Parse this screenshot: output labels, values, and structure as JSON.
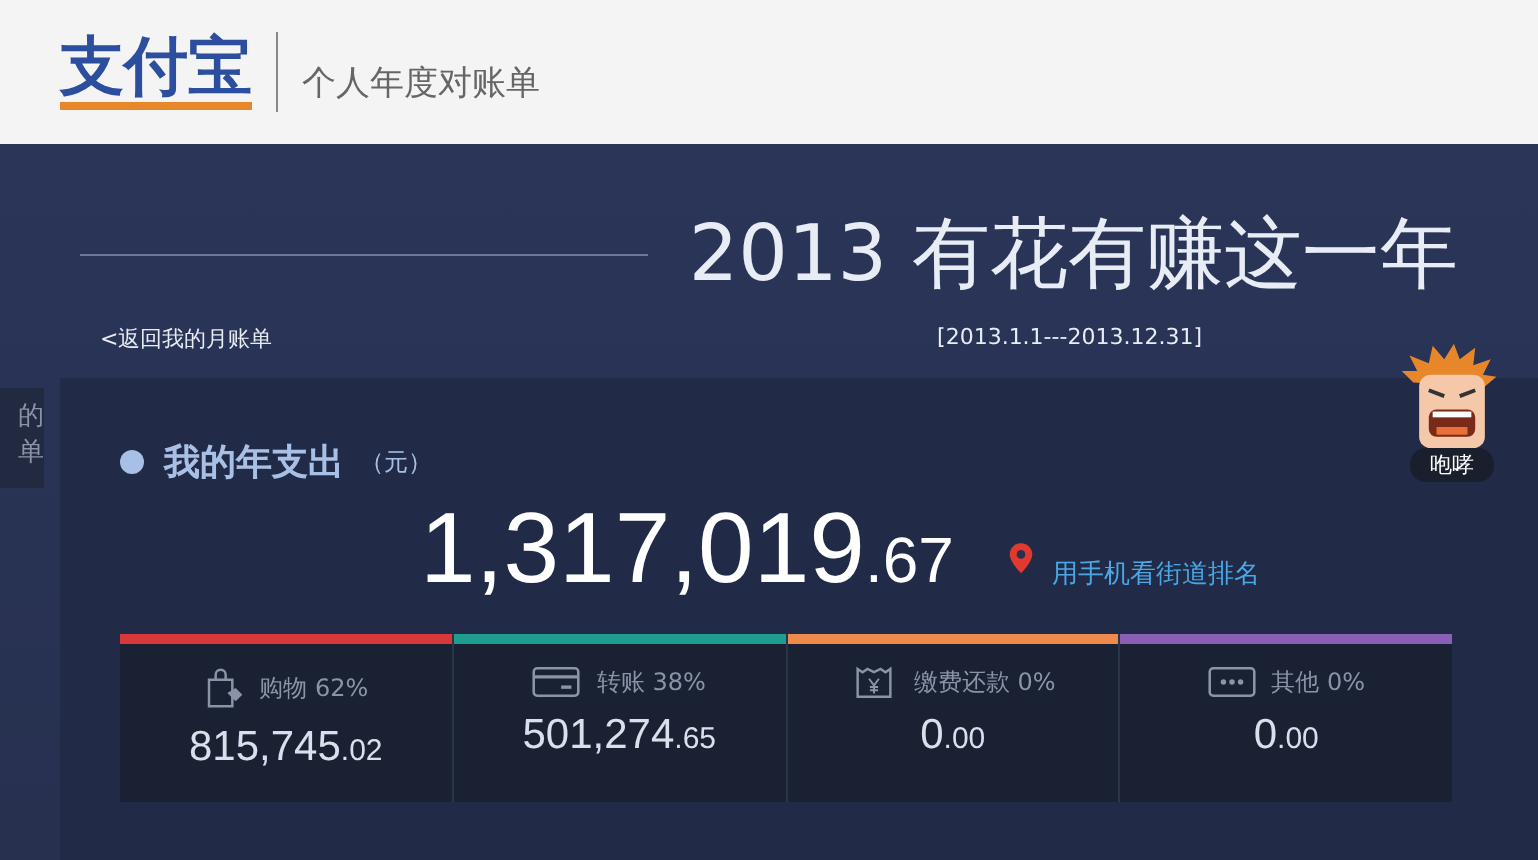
{
  "header": {
    "logo": "支付宝",
    "subtitle": "个人年度对账单"
  },
  "title": "2013 有花有赚这一年",
  "back_link": "<返回我的月账单",
  "date_range": "[2013.1.1---2013.12.31]",
  "side_tab": [
    "的",
    "单"
  ],
  "mascot": {
    "label": "咆哮"
  },
  "spending": {
    "heading": "我的年支出",
    "unit": "（元）",
    "integer": "1,317,019",
    "decimal": ".67",
    "link": "用手机看街道排名"
  },
  "categories": [
    {
      "kind": "shopping",
      "label": "购物 62%",
      "integer": "815,745",
      "decimal": ".02",
      "color": "#d9383a"
    },
    {
      "kind": "transfer",
      "label": "转账 38%",
      "integer": "501,274",
      "decimal": ".65",
      "color": "#1f9e8f"
    },
    {
      "kind": "bills",
      "label": "缴费还款 0%",
      "integer": "0",
      "decimal": ".00",
      "color": "#f08a4b"
    },
    {
      "kind": "other",
      "label": "其他 0%",
      "integer": "0",
      "decimal": ".00",
      "color": "#8a5fb5"
    }
  ]
}
